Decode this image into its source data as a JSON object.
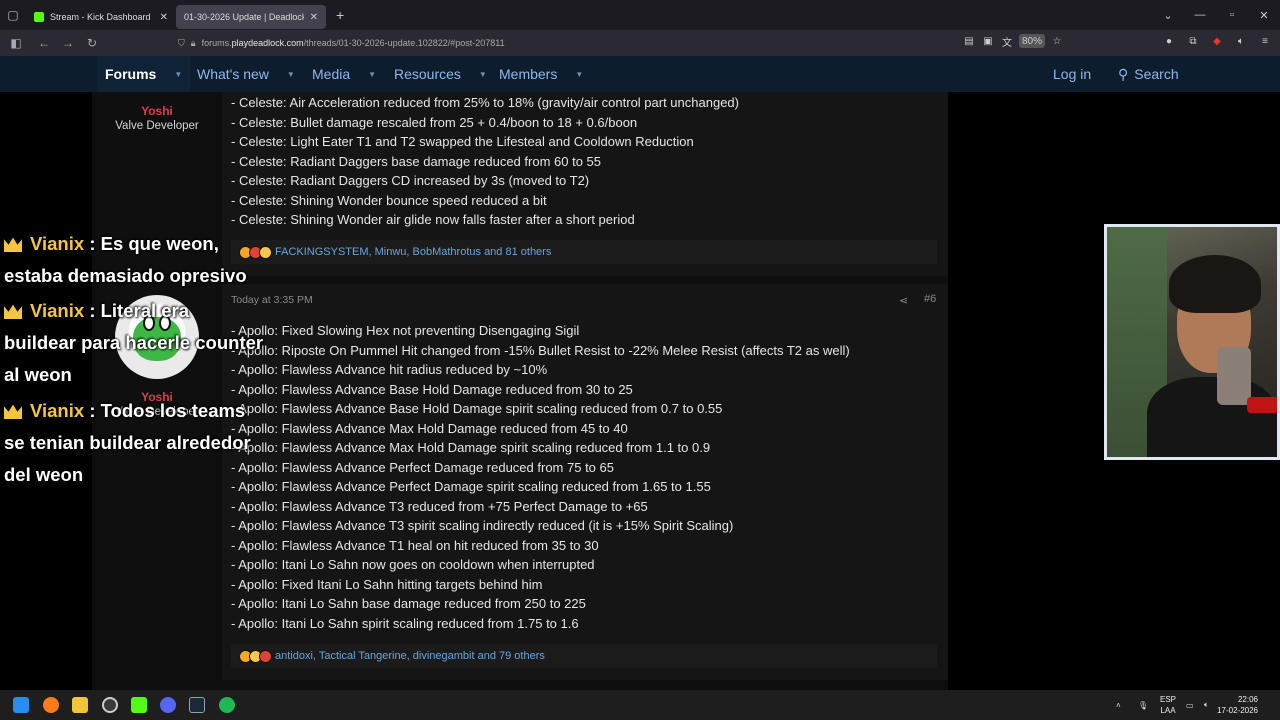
{
  "browser": {
    "tabs": [
      {
        "title": "Stream - Kick Dashboard",
        "active": false
      },
      {
        "title": "01-30-2026 Update | Deadlock",
        "active": true
      }
    ],
    "url_host": "forums.playdeadlock.com",
    "url_path": "/threads/01-30-2026-update.102822/#post-207811",
    "url_prefix": "forums.",
    "url_domain": "playdeadlock.com",
    "zoom": "80%"
  },
  "site_nav": {
    "items": [
      {
        "label": "Forums",
        "active": true
      },
      {
        "label": "What's new"
      },
      {
        "label": "Media"
      },
      {
        "label": "Resources"
      },
      {
        "label": "Members"
      }
    ],
    "login": "Log in",
    "search": "Search"
  },
  "post1": {
    "author": "Yoshi",
    "role": "Valve Developer",
    "lines": [
      "- Celeste: Air Acceleration reduced from 25% to 18% (gravity/air control part unchanged)",
      "- Celeste: Bullet damage rescaled from 25 + 0.4/boon to 18 + 0.6/boon",
      "- Celeste: Light Eater T1 and T2 swapped the Lifesteal and Cooldown Reduction",
      "- Celeste: Radiant Daggers base damage reduced from 60 to 55",
      "- Celeste: Radiant Daggers CD increased by 3s (moved to T2)",
      "- Celeste: Shining Wonder bounce speed reduced a bit",
      "- Celeste: Shining Wonder air glide now falls faster after a short period"
    ],
    "reactions": "FACKINGSYSTEM, Minwu, BobMathrotus and 81 others"
  },
  "post2": {
    "author": "Yoshi",
    "role": "Valve Developer",
    "time": "Today at 3:35 PM",
    "number": "#6",
    "lines": [
      "- Apollo: Fixed Slowing Hex not preventing Disengaging Sigil",
      "- Apollo: Riposte On Pummel Hit changed from -15% Bullet Resist to -22% Melee Resist (affects T2 as well)",
      "- Apollo: Flawless Advance hit radius reduced by ~10%",
      "- Apollo: Flawless Advance Base Hold Damage reduced from 30 to 25",
      "- Apollo: Flawless Advance Base Hold Damage spirit scaling reduced from 0.7 to 0.55",
      "- Apollo: Flawless Advance Max Hold Damage reduced from 45 to 40",
      "- Apollo: Flawless Advance Max Hold Damage spirit scaling reduced from 1.1 to 0.9",
      "- Apollo: Flawless Advance Perfect Damage reduced from 75 to 65",
      "- Apollo: Flawless Advance Perfect Damage spirit scaling reduced from 1.65 to 1.55",
      "- Apollo: Flawless Advance T3 reduced from +75 Perfect Damage to +65",
      "- Apollo: Flawless Advance T3 spirit scaling indirectly reduced (it is +15% Spirit Scaling)",
      "- Apollo: Flawless Advance T1 heal on hit reduced from 35 to 30",
      "- Apollo: Itani Lo Sahn now goes on cooldown when interrupted",
      "- Apollo: Fixed Itani Lo Sahn hitting targets behind him",
      "- Apollo: Itani Lo Sahn base damage reduced from 250 to 225",
      "- Apollo: Itani Lo Sahn spirit scaling reduced from 1.75 to 1.6"
    ],
    "reactions": "antidoxi, Tactical Tangerine, divinegambit and 79 others"
  },
  "chat": [
    {
      "user": "Vianix",
      "text": ": Es que weon,",
      "cont": [
        "estaba demasiado opresivo"
      ]
    },
    {
      "user": "Vianix",
      "text": ": Literal era",
      "cont": [
        "buildear para hacerle counter",
        "al weon"
      ]
    },
    {
      "user": "Vianix",
      "text": ": Todos los teams",
      "cont": [
        "se tenian buildear alrededor",
        "del weon"
      ]
    }
  ],
  "taskbar": {
    "lang_top": "ESP",
    "lang_bottom": "LAA",
    "time": "22:06",
    "date": "17-02-2026"
  },
  "colors": {
    "nav_bg": "#0d1d2e",
    "nav_link": "#8cbaec",
    "author": "#e2384d",
    "reaction_link": "#6aa6de",
    "chat_user": "#f5c542"
  }
}
